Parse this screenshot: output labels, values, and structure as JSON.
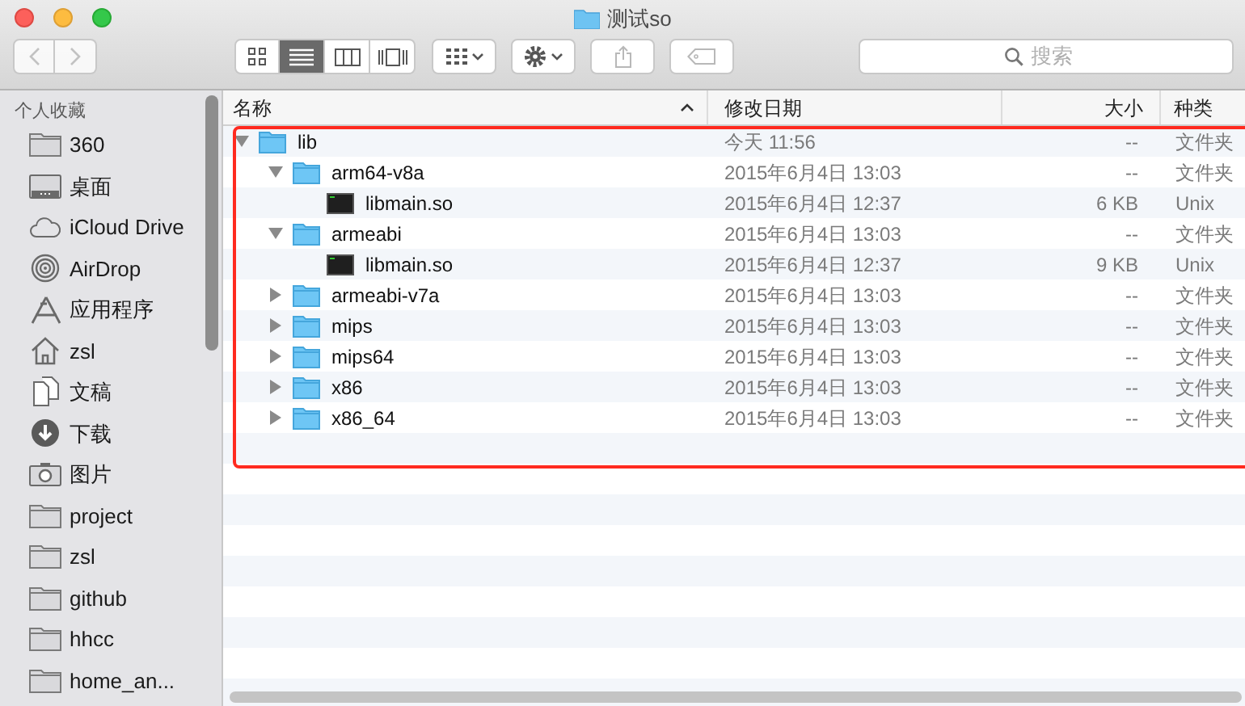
{
  "window": {
    "title": "测试so"
  },
  "toolbar": {
    "search": {
      "placeholder": "搜索"
    },
    "view_modes": [
      {
        "kind": "icons",
        "selected": false
      },
      {
        "kind": "list",
        "selected": true
      },
      {
        "kind": "columns",
        "selected": false
      },
      {
        "kind": "coverflow",
        "selected": false
      }
    ]
  },
  "sidebar": {
    "section": "个人收藏",
    "items": [
      {
        "label": "360",
        "kind": "folder"
      },
      {
        "label": "桌面",
        "kind": "desktop"
      },
      {
        "label": "iCloud Drive",
        "kind": "cloud"
      },
      {
        "label": "AirDrop",
        "kind": "airdrop"
      },
      {
        "label": "应用程序",
        "kind": "apps"
      },
      {
        "label": "zsl",
        "kind": "home"
      },
      {
        "label": "文稿",
        "kind": "documents"
      },
      {
        "label": "下载",
        "kind": "downloads"
      },
      {
        "label": "图片",
        "kind": "pictures"
      },
      {
        "label": "project",
        "kind": "folder"
      },
      {
        "label": "zsl",
        "kind": "folder"
      },
      {
        "label": "github",
        "kind": "folder"
      },
      {
        "label": "hhcc",
        "kind": "folder"
      },
      {
        "label": "home_an...",
        "kind": "folder"
      }
    ]
  },
  "table": {
    "columns": [
      "名称",
      "修改日期",
      "大小",
      "种类"
    ],
    "rows": [
      {
        "name": "lib",
        "kind": "folder",
        "date": "今天 11:56",
        "size": "--",
        "type": "文件夹",
        "expanded": true,
        "children": [
          {
            "name": "arm64-v8a",
            "kind": "folder",
            "date": "2015年6月4日 13:03",
            "size": "--",
            "type": "文件夹",
            "expanded": true,
            "children": [
              {
                "name": "libmain.so",
                "kind": "executable",
                "date": "2015年6月4日 12:37",
                "size": "6 KB",
                "type": "Unix"
              }
            ]
          },
          {
            "name": "armeabi",
            "kind": "folder",
            "date": "2015年6月4日 13:03",
            "size": "--",
            "type": "文件夹",
            "expanded": true,
            "children": [
              {
                "name": "libmain.so",
                "kind": "executable",
                "date": "2015年6月4日 12:37",
                "size": "9 KB",
                "type": "Unix"
              }
            ]
          },
          {
            "name": "armeabi-v7a",
            "kind": "folder",
            "date": "2015年6月4日 13:03",
            "size": "--",
            "type": "文件夹",
            "expanded": false
          },
          {
            "name": "mips",
            "kind": "folder",
            "date": "2015年6月4日 13:03",
            "size": "--",
            "type": "文件夹",
            "expanded": false
          },
          {
            "name": "mips64",
            "kind": "folder",
            "date": "2015年6月4日 13:03",
            "size": "--",
            "type": "文件夹",
            "expanded": false
          },
          {
            "name": "x86",
            "kind": "folder",
            "date": "2015年6月4日 13:03",
            "size": "--",
            "type": "文件夹",
            "expanded": false
          },
          {
            "name": "x86_64",
            "kind": "folder",
            "date": "2015年6月4日 13:03",
            "size": "--",
            "type": "文件夹",
            "expanded": false
          }
        ]
      }
    ]
  },
  "annotation": {
    "kind": "frame",
    "color": "#ff2a1f"
  }
}
